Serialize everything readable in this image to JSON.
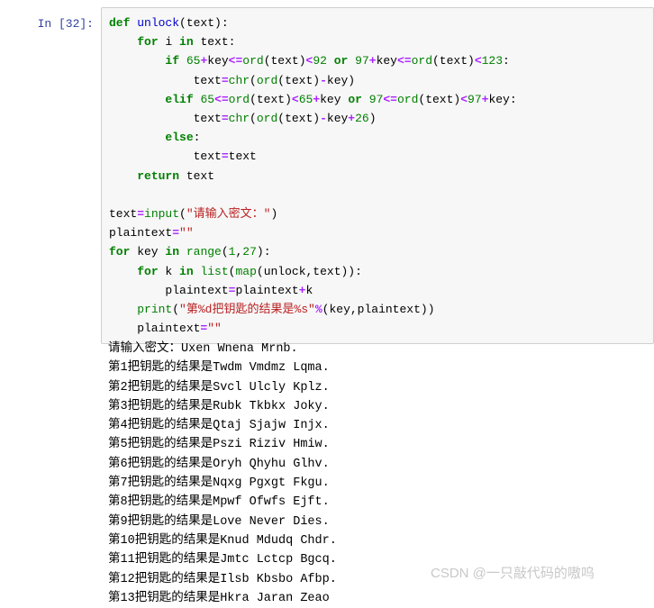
{
  "cell": {
    "prompt": "In [32]:",
    "code_lines": [
      [
        {
          "t": "def ",
          "c": "kw"
        },
        {
          "t": "unlock",
          "c": "fn"
        },
        {
          "t": "(text):",
          "c": "pl"
        }
      ],
      [
        {
          "t": "    ",
          "c": "pl"
        },
        {
          "t": "for",
          "c": "kw"
        },
        {
          "t": " i ",
          "c": "pl"
        },
        {
          "t": "in",
          "c": "kw"
        },
        {
          "t": " text:",
          "c": "pl"
        }
      ],
      [
        {
          "t": "        ",
          "c": "pl"
        },
        {
          "t": "if",
          "c": "kw"
        },
        {
          "t": " ",
          "c": "pl"
        },
        {
          "t": "65",
          "c": "num"
        },
        {
          "t": "+",
          "c": "op"
        },
        {
          "t": "key",
          "c": "pl"
        },
        {
          "t": "<=",
          "c": "op"
        },
        {
          "t": "ord",
          "c": "bi"
        },
        {
          "t": "(text)",
          "c": "pl"
        },
        {
          "t": "<",
          "c": "op"
        },
        {
          "t": "92",
          "c": "num"
        },
        {
          "t": " ",
          "c": "pl"
        },
        {
          "t": "or",
          "c": "kw"
        },
        {
          "t": " ",
          "c": "pl"
        },
        {
          "t": "97",
          "c": "num"
        },
        {
          "t": "+",
          "c": "op"
        },
        {
          "t": "key",
          "c": "pl"
        },
        {
          "t": "<=",
          "c": "op"
        },
        {
          "t": "ord",
          "c": "bi"
        },
        {
          "t": "(text)",
          "c": "pl"
        },
        {
          "t": "<",
          "c": "op"
        },
        {
          "t": "123",
          "c": "num"
        },
        {
          "t": ":",
          "c": "pl"
        }
      ],
      [
        {
          "t": "            text",
          "c": "pl"
        },
        {
          "t": "=",
          "c": "op"
        },
        {
          "t": "chr",
          "c": "bi"
        },
        {
          "t": "(",
          "c": "pl"
        },
        {
          "t": "ord",
          "c": "bi"
        },
        {
          "t": "(text)",
          "c": "pl"
        },
        {
          "t": "-",
          "c": "op"
        },
        {
          "t": "key)",
          "c": "pl"
        }
      ],
      [
        {
          "t": "        ",
          "c": "pl"
        },
        {
          "t": "elif",
          "c": "kw"
        },
        {
          "t": " ",
          "c": "pl"
        },
        {
          "t": "65",
          "c": "num"
        },
        {
          "t": "<=",
          "c": "op"
        },
        {
          "t": "ord",
          "c": "bi"
        },
        {
          "t": "(text)",
          "c": "pl"
        },
        {
          "t": "<",
          "c": "op"
        },
        {
          "t": "65",
          "c": "num"
        },
        {
          "t": "+",
          "c": "op"
        },
        {
          "t": "key",
          "c": "pl"
        },
        {
          "t": " ",
          "c": "pl"
        },
        {
          "t": "or",
          "c": "kw"
        },
        {
          "t": " ",
          "c": "pl"
        },
        {
          "t": "97",
          "c": "num"
        },
        {
          "t": "<=",
          "c": "op"
        },
        {
          "t": "ord",
          "c": "bi"
        },
        {
          "t": "(text)",
          "c": "pl"
        },
        {
          "t": "<",
          "c": "op"
        },
        {
          "t": "97",
          "c": "num"
        },
        {
          "t": "+",
          "c": "op"
        },
        {
          "t": "key:",
          "c": "pl"
        }
      ],
      [
        {
          "t": "            text",
          "c": "pl"
        },
        {
          "t": "=",
          "c": "op"
        },
        {
          "t": "chr",
          "c": "bi"
        },
        {
          "t": "(",
          "c": "pl"
        },
        {
          "t": "ord",
          "c": "bi"
        },
        {
          "t": "(text)",
          "c": "pl"
        },
        {
          "t": "-",
          "c": "op"
        },
        {
          "t": "key",
          "c": "pl"
        },
        {
          "t": "+",
          "c": "op"
        },
        {
          "t": "26",
          "c": "num"
        },
        {
          "t": ")",
          "c": "pl"
        }
      ],
      [
        {
          "t": "        ",
          "c": "pl"
        },
        {
          "t": "else",
          "c": "kw"
        },
        {
          "t": ":",
          "c": "pl"
        }
      ],
      [
        {
          "t": "            text",
          "c": "pl"
        },
        {
          "t": "=",
          "c": "op"
        },
        {
          "t": "text",
          "c": "pl"
        }
      ],
      [
        {
          "t": "    ",
          "c": "pl"
        },
        {
          "t": "return",
          "c": "kw"
        },
        {
          "t": " text",
          "c": "pl"
        }
      ],
      [
        {
          "t": "",
          "c": "pl"
        }
      ],
      [
        {
          "t": "text",
          "c": "pl"
        },
        {
          "t": "=",
          "c": "op"
        },
        {
          "t": "input",
          "c": "bi"
        },
        {
          "t": "(",
          "c": "pl"
        },
        {
          "t": "\"请输入密文：\"",
          "c": "str"
        },
        {
          "t": ")",
          "c": "pl"
        }
      ],
      [
        {
          "t": "plaintext",
          "c": "pl"
        },
        {
          "t": "=",
          "c": "op"
        },
        {
          "t": "\"\"",
          "c": "str"
        }
      ],
      [
        {
          "t": "for",
          "c": "kw"
        },
        {
          "t": " key ",
          "c": "pl"
        },
        {
          "t": "in",
          "c": "kw"
        },
        {
          "t": " ",
          "c": "pl"
        },
        {
          "t": "range",
          "c": "bi"
        },
        {
          "t": "(",
          "c": "pl"
        },
        {
          "t": "1",
          "c": "num"
        },
        {
          "t": ",",
          "c": "pl"
        },
        {
          "t": "27",
          "c": "num"
        },
        {
          "t": "):",
          "c": "pl"
        }
      ],
      [
        {
          "t": "    ",
          "c": "pl"
        },
        {
          "t": "for",
          "c": "kw"
        },
        {
          "t": " k ",
          "c": "pl"
        },
        {
          "t": "in",
          "c": "kw"
        },
        {
          "t": " ",
          "c": "pl"
        },
        {
          "t": "list",
          "c": "bi"
        },
        {
          "t": "(",
          "c": "pl"
        },
        {
          "t": "map",
          "c": "bi"
        },
        {
          "t": "(unlock,text)):",
          "c": "pl"
        }
      ],
      [
        {
          "t": "        plaintext",
          "c": "pl"
        },
        {
          "t": "=",
          "c": "op"
        },
        {
          "t": "plaintext",
          "c": "pl"
        },
        {
          "t": "+",
          "c": "op"
        },
        {
          "t": "k",
          "c": "pl"
        }
      ],
      [
        {
          "t": "    ",
          "c": "pl"
        },
        {
          "t": "print",
          "c": "bi"
        },
        {
          "t": "(",
          "c": "pl"
        },
        {
          "t": "\"第%d把钥匙的结果是%s\"",
          "c": "str"
        },
        {
          "t": "%",
          "c": "op"
        },
        {
          "t": "(key,plaintext))",
          "c": "pl"
        }
      ],
      [
        {
          "t": "    plaintext",
          "c": "pl"
        },
        {
          "t": "=",
          "c": "op"
        },
        {
          "t": "\"\"",
          "c": "str"
        }
      ]
    ]
  },
  "output": {
    "lines": [
      "请输入密文：Uxen Wnena Mrnb.",
      "第1把钥匙的结果是Twdm Vmdmz Lqma.",
      "第2把钥匙的结果是Svcl Ulcly Kplz.",
      "第3把钥匙的结果是Rubk Tkbkx Joky.",
      "第4把钥匙的结果是Qtaj Sjajw Injx.",
      "第5把钥匙的结果是Pszi Riziv Hmiw.",
      "第6把钥匙的结果是Oryh Qhyhu Glhv.",
      "第7把钥匙的结果是Nqxg Pgxgt Fkgu.",
      "第8把钥匙的结果是Mpwf Ofwfs Ejft.",
      "第9把钥匙的结果是Love Never Dies.",
      "第10把钥匙的结果是Knud Mdudq Chdr.",
      "第11把钥匙的结果是Jmtc Lctcp Bgcq.",
      "第12把钥匙的结果是Ilsb Kbsbo Afbp.",
      "第13把钥匙的结果是Hkra Jaran Zeao"
    ]
  },
  "watermark": {
    "text": "CSDN @一只敲代码的嗷呜"
  },
  "colors": {
    "keyword": "#008000",
    "function": "#0000CD",
    "builtin": "#008000",
    "number": "#008000",
    "operator": "#AA22FF",
    "string": "#BA2121",
    "prompt": "#303F9F",
    "cell_bg": "#f7f7f7",
    "cell_border": "#cfcfcf",
    "watermark": "#c8c8c8"
  }
}
